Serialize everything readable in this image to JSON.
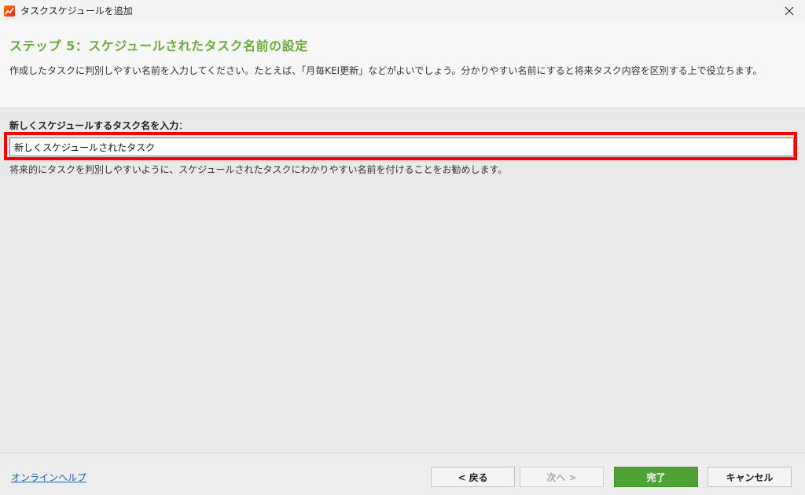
{
  "window": {
    "title": "タスクスケジュールを追加",
    "close_icon": "close-icon",
    "app_icon": "app-logo-icon"
  },
  "header": {
    "step_title": "ステップ 5：スケジュールされたタスク名前の設定",
    "description": "作成したタスクに判別しやすい名前を入力してください。たとえば、「月毎KEI更新」などがよいでしょう。分かりやすい名前にすると将来タスク内容を区別する上で役立ちます。"
  },
  "form": {
    "label": "新しくスケジュールするタスク名を入力",
    "label_suffix": "：",
    "task_name_value": "新しくスケジュールされたタスク",
    "hint": "将来的にタスクを判別しやすいように、スケジュールされたタスクにわかりやすい名前を付けることをお勧めします。"
  },
  "footer": {
    "help_link": "オンラインヘルプ",
    "back_label": "< 戻る",
    "next_label": "次へ >",
    "finish_label": "完了",
    "cancel_label": "キャンセル"
  },
  "colors": {
    "accent_green": "#6aaa3a",
    "finish_button": "#4fa334",
    "highlight_red": "#ff0000",
    "link_blue": "#1a5fb4"
  }
}
